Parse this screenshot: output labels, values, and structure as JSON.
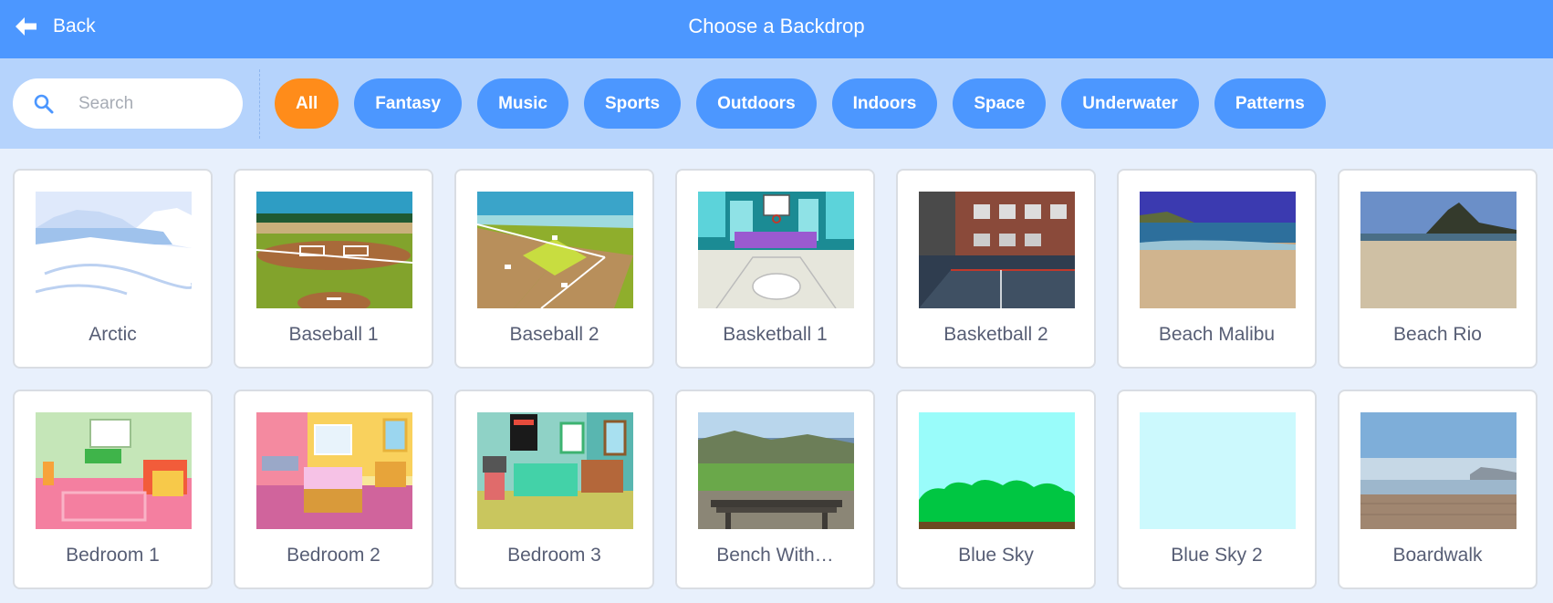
{
  "header": {
    "back_label": "Back",
    "title": "Choose a Backdrop"
  },
  "search": {
    "placeholder": "Search",
    "value": ""
  },
  "tags": [
    "All",
    "Fantasy",
    "Music",
    "Sports",
    "Outdoors",
    "Indoors",
    "Space",
    "Underwater",
    "Patterns"
  ],
  "active_tag": "All",
  "colors": {
    "header": "#4c97ff",
    "filter_bar": "#b5d3fc",
    "active_tag": "#ff8c1a",
    "page_bg": "#e8f0fc"
  },
  "backdrops": [
    {
      "name": "Arctic",
      "thumb": "arctic"
    },
    {
      "name": "Baseball 1",
      "thumb": "baseball1"
    },
    {
      "name": "Baseball 2",
      "thumb": "baseball2"
    },
    {
      "name": "Basketball 1",
      "thumb": "basketball1"
    },
    {
      "name": "Basketball 2",
      "thumb": "basketball2"
    },
    {
      "name": "Beach Malibu",
      "thumb": "beach-malibu"
    },
    {
      "name": "Beach Rio",
      "thumb": "beach-rio"
    },
    {
      "name": "Bedroom 1",
      "thumb": "bedroom1"
    },
    {
      "name": "Bedroom 2",
      "thumb": "bedroom2"
    },
    {
      "name": "Bedroom 3",
      "thumb": "bedroom3"
    },
    {
      "name": "Bench With…",
      "thumb": "bench"
    },
    {
      "name": "Blue Sky",
      "thumb": "blue-sky"
    },
    {
      "name": "Blue Sky 2",
      "thumb": "blue-sky-2"
    },
    {
      "name": "Boardwalk",
      "thumb": "boardwalk"
    }
  ]
}
